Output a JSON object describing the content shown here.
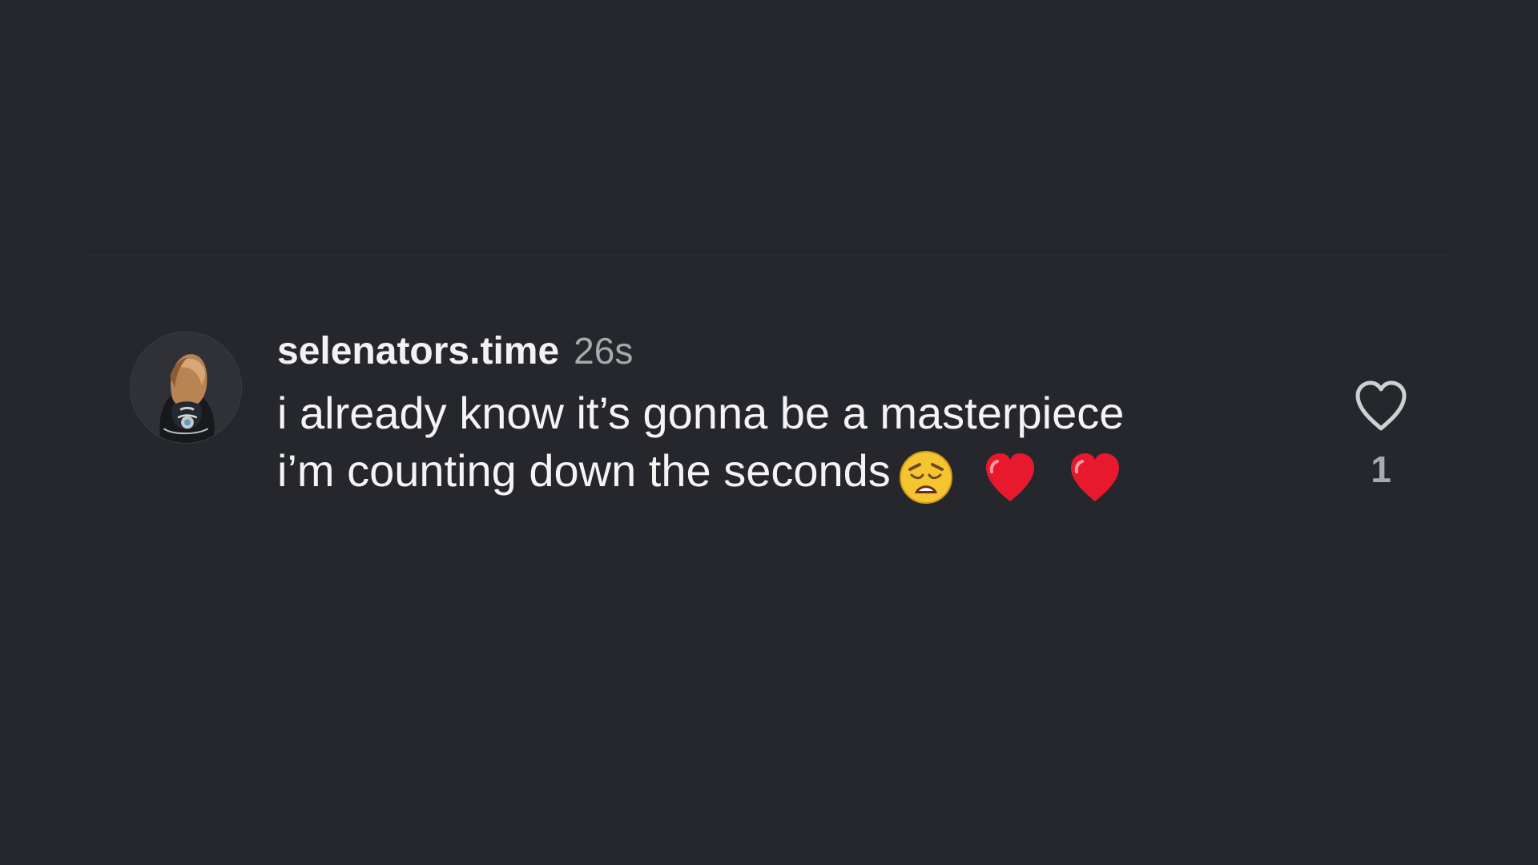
{
  "comment": {
    "username": "selenators.time",
    "timestamp": "26s",
    "text_line_1": "i already know it’s gonna be a masterpiece",
    "text_line_2": "i’m counting down the seconds",
    "emojis": [
      "weary-face-emoji",
      "red-heart-emoji",
      "red-heart-emoji"
    ],
    "like_count": "1"
  },
  "icons": {
    "like": "heart-outline-icon"
  },
  "colors": {
    "background": "#25272c",
    "text": "#f4f4f4",
    "muted": "#a8a9ad",
    "heart_red": "#e8192c"
  }
}
